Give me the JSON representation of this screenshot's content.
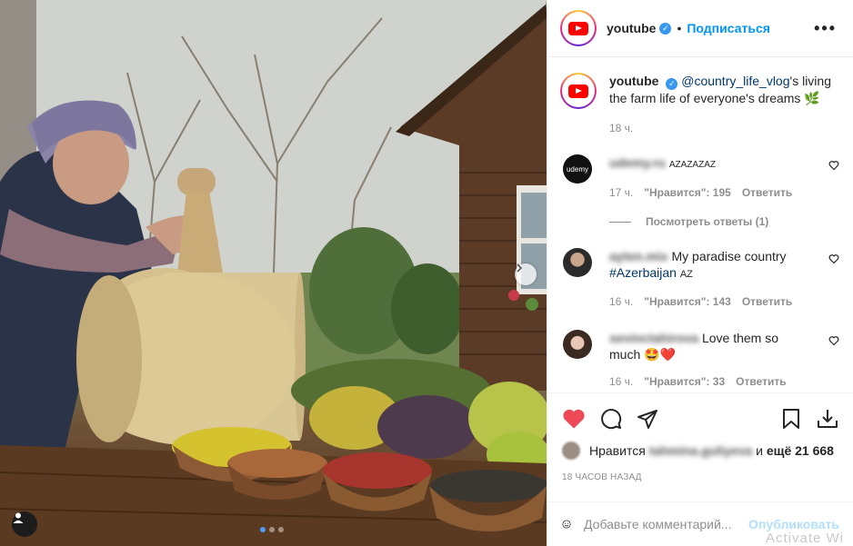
{
  "photo": {
    "carousel_index": 1,
    "carousel_count": 3
  },
  "header": {
    "username": "youtube",
    "verified_mark": "✓",
    "separator": "•",
    "follow_label": "Подписаться",
    "more_label": "•••"
  },
  "caption": {
    "username": "youtube",
    "mention": "@country_life_vlog",
    "text": "'s living the farm life of everyone's dreams",
    "emoji": "🌿",
    "time": "18 ч."
  },
  "comments": [
    {
      "user": "udemy.ru",
      "avatar_text": "udemy",
      "text": "AZAZAZAZ",
      "time": "17 ч.",
      "likes": "\"Нравится\": 195",
      "reply": "Ответить",
      "view_replies": "Посмотреть ответы (1)"
    },
    {
      "user": "ayten.mix",
      "text": "My paradise country",
      "hashtag": "#Azerbaijan",
      "suffix": "AZ",
      "time": "16 ч.",
      "likes": "\"Нравится\": 143",
      "reply": "Ответить"
    },
    {
      "user": "sevinctahirova",
      "text": "Love them so much",
      "emoji": "🤩❤️",
      "time": "16 ч.",
      "likes": "\"Нравится\": 33",
      "reply": "Ответить"
    }
  ],
  "likes": {
    "prefix": "Нравится",
    "user": "tahmina.guliyeva",
    "middle": "и",
    "suffix": "ещё 21 668"
  },
  "time_ago": "18 ЧАСОВ НАЗАД",
  "add_comment": {
    "placeholder": "Добавьте комментарий...",
    "publish_label": "Опубликовать"
  },
  "watermark": "Activate Wi",
  "icons": {
    "like": "heart-filled-icon",
    "comment": "comment-icon",
    "share": "share-icon",
    "save": "bookmark-icon",
    "download": "download-icon",
    "emoji": "emoji-icon"
  },
  "colors": {
    "like_red": "#ed4956",
    "link_blue": "#0095f6",
    "publish_disabled": "#b2dffc"
  }
}
